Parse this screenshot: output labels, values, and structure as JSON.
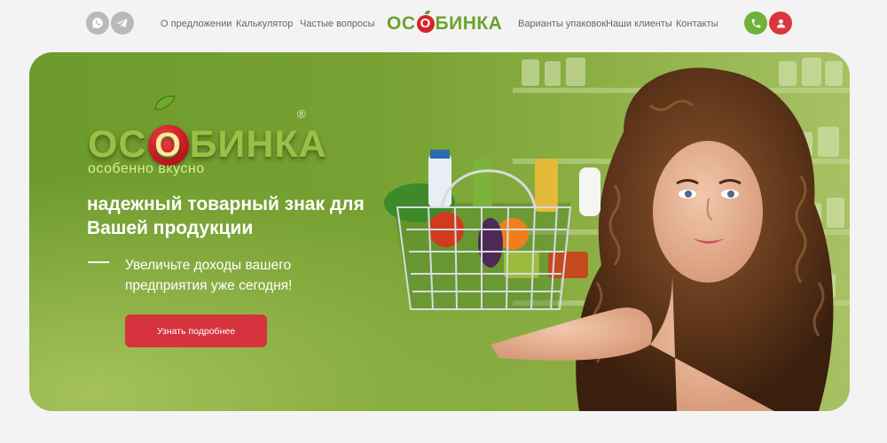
{
  "header": {
    "social": {
      "whatsapp_icon": "whatsapp-icon",
      "telegram_icon": "telegram-icon"
    },
    "nav_left": [
      "О предложении",
      "Калькулятор",
      "Частые вопросы"
    ],
    "logo_text_left": "ОС",
    "logo_text_o": "О",
    "logo_text_right": "БИНКА",
    "nav_right": [
      "Варианты упаковок",
      "Наши клиенты",
      "Контакты"
    ],
    "phone_icon": "phone-icon",
    "user_icon": "user-icon"
  },
  "hero": {
    "brand_left": "ОС",
    "brand_o": "О",
    "brand_right": "БИНКА",
    "registered": "®",
    "tagline": "особенно вкусно",
    "headline": "надежный товарный знак для Вашей продукции",
    "subtext": "Увеличьте доходы вашего предприятия уже сегодня!",
    "cta_label": "Узнать подробнее"
  },
  "colors": {
    "brand_green": "#6aa32a",
    "brand_red": "#d6232b",
    "cta_red": "#d6333e",
    "phone_green": "#6fb13b",
    "user_red": "#d9363e"
  }
}
